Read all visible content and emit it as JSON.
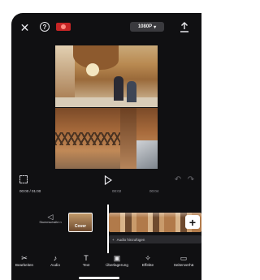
{
  "topbar": {
    "resolution": "1080P",
    "close_icon": "close-icon",
    "help_icon": "help-icon",
    "export_icon": "export-icon"
  },
  "timeline": {
    "timecode": "00:00 / 01:00",
    "ticks": [
      "00:00",
      "00:02",
      "00:04"
    ],
    "mute_label": "Stummschalte n",
    "cover_label": "Cover",
    "add_audio_label": "Audio hinzufügen"
  },
  "toolbar": {
    "items": [
      {
        "label": "Bearbeiten",
        "icon": "scissors-icon"
      },
      {
        "label": "Audio",
        "icon": "music-note-icon"
      },
      {
        "label": "Text",
        "icon": "text-icon"
      },
      {
        "label": "Überlagerung",
        "icon": "overlay-icon"
      },
      {
        "label": "Effekte",
        "icon": "effects-icon"
      },
      {
        "label": "Seitenverhä",
        "icon": "aspect-ratio-icon"
      }
    ]
  },
  "colors": {
    "background": "#101012",
    "record": "#c62525",
    "accent": "#ffffff"
  }
}
